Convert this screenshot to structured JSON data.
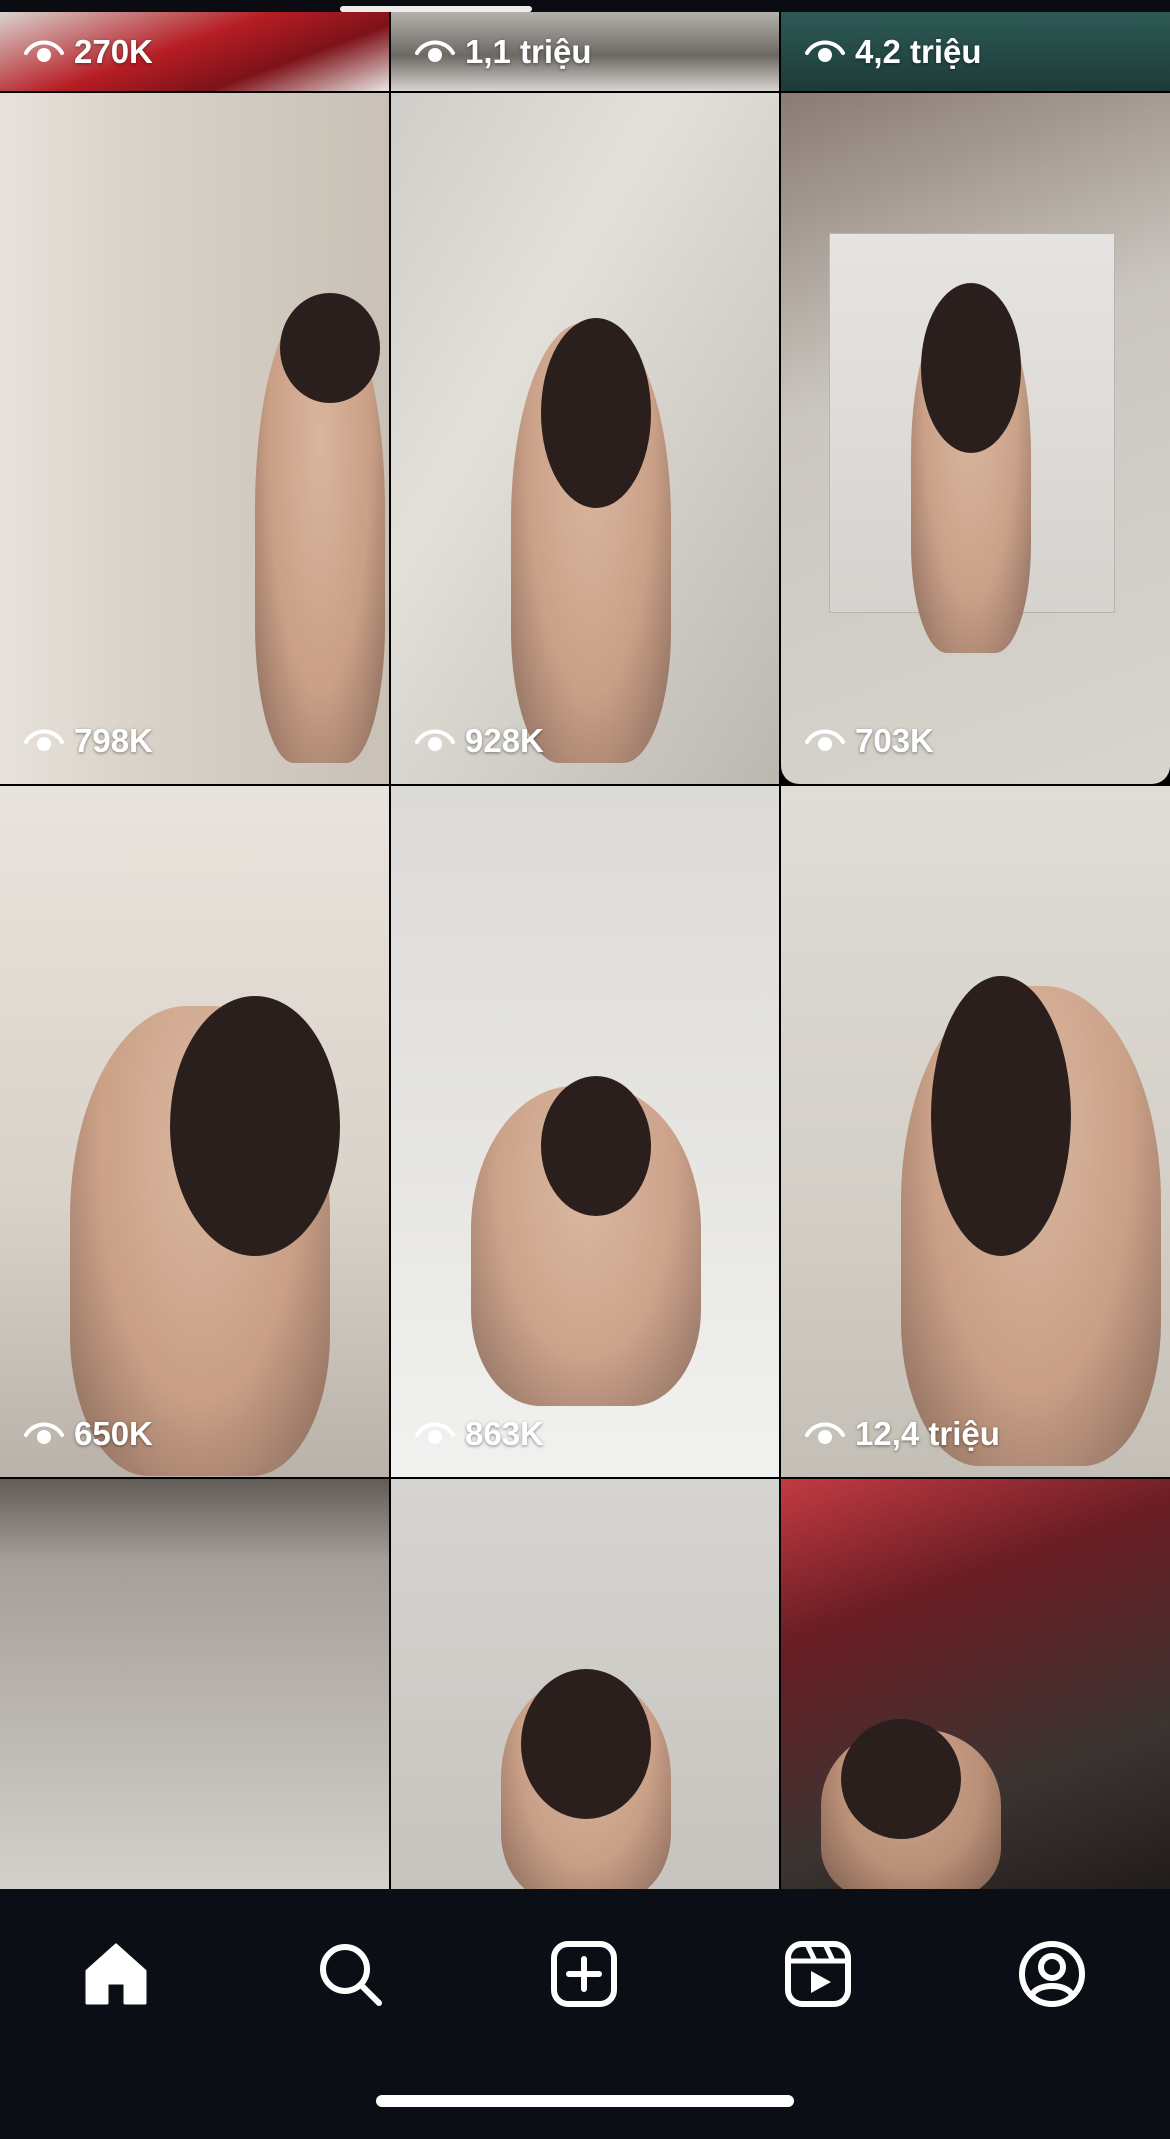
{
  "grid": {
    "tiles": [
      {
        "views": "270K"
      },
      {
        "views": "1,1 triệu"
      },
      {
        "views": "4,2 triệu"
      },
      {
        "views": "798K"
      },
      {
        "views": "928K"
      },
      {
        "views": "703K"
      },
      {
        "views": "650K"
      },
      {
        "views": "863K"
      },
      {
        "views": "12,4 triệu"
      },
      {
        "views": ""
      },
      {
        "views": ""
      },
      {
        "views": ""
      }
    ]
  },
  "bottom_nav": {
    "items": [
      {
        "icon": "home-icon",
        "active": true
      },
      {
        "icon": "search-icon",
        "active": false
      },
      {
        "icon": "create-post-icon",
        "active": false
      },
      {
        "icon": "reels-icon",
        "active": false
      },
      {
        "icon": "profile-icon",
        "active": false
      }
    ]
  },
  "colors": {
    "background": "#000000",
    "nav_background": "#0b0e14",
    "icon": "#ffffff"
  }
}
